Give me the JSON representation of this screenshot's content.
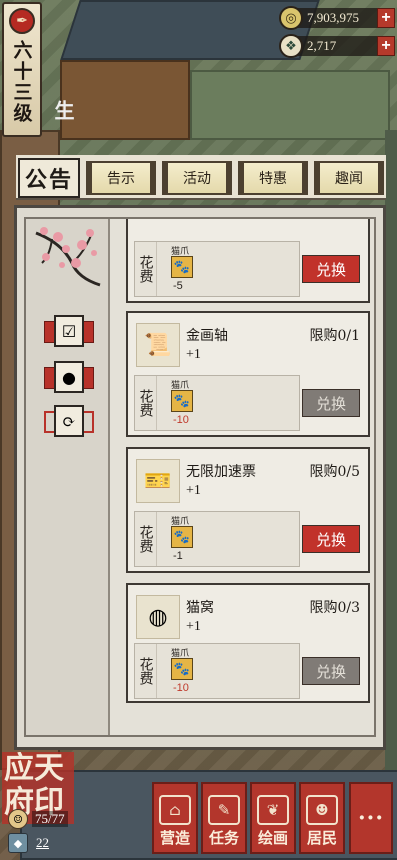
{
  "level": {
    "text": "六十三级",
    "icon": "red-seal-icon"
  },
  "currencies": [
    {
      "icon": "copper-coin-icon",
      "value": "7,903,975",
      "plus": "+"
    },
    {
      "icon": "jade-icon",
      "value": "2,717",
      "plus": "+"
    }
  ],
  "background": {
    "wall_text": "生"
  },
  "header": {
    "notice_label": "公告"
  },
  "tabs": [
    "告示",
    "活动",
    "特惠",
    "趣闻"
  ],
  "side_buttons": [
    {
      "icon": "checklist-icon"
    },
    {
      "icon": "money-bag-icon"
    },
    {
      "icon": "refresh-icon"
    }
  ],
  "cost_label": "花费",
  "items": [
    {
      "name": "",
      "limit": "",
      "qty": "",
      "icon": "",
      "cost_name": "猫爪",
      "cost_amount": "-5",
      "cost_red": false,
      "button": "兑换",
      "enabled": true
    },
    {
      "name": "金画轴",
      "limit": "限购0/1",
      "qty": "+1",
      "icon": "scroll-icon",
      "cost_name": "猫爪",
      "cost_amount": "-10",
      "cost_red": true,
      "button": "兑换",
      "enabled": false
    },
    {
      "name": "无限加速票",
      "limit": "限购0/5",
      "qty": "+1",
      "icon": "ticket-icon",
      "cost_name": "猫爪",
      "cost_amount": "-1",
      "cost_red": false,
      "button": "兑换",
      "enabled": true
    },
    {
      "name": "猫窝",
      "limit": "限购0/3",
      "qty": "+1",
      "icon": "cat-bed-icon",
      "cost_name": "猫爪",
      "cost_amount": "-10",
      "cost_red": true,
      "button": "兑换",
      "enabled": false
    }
  ],
  "seal": {
    "text": "应天府印"
  },
  "stamina": {
    "value": "75/77",
    "icon": "stamina-icon"
  },
  "gems": {
    "value": "22",
    "icon": "gem-icon"
  },
  "nav": [
    {
      "label": "营造",
      "icon": "building-icon"
    },
    {
      "label": "任务",
      "icon": "task-book-icon"
    },
    {
      "label": "绘画",
      "icon": "painting-icon"
    },
    {
      "label": "居民",
      "icon": "resident-icon"
    },
    {
      "label": "···",
      "icon": "more-icon"
    }
  ],
  "colors": {
    "accent_red": "#c1322a",
    "disabled_gray": "#807b76",
    "paper": "#efece4"
  }
}
